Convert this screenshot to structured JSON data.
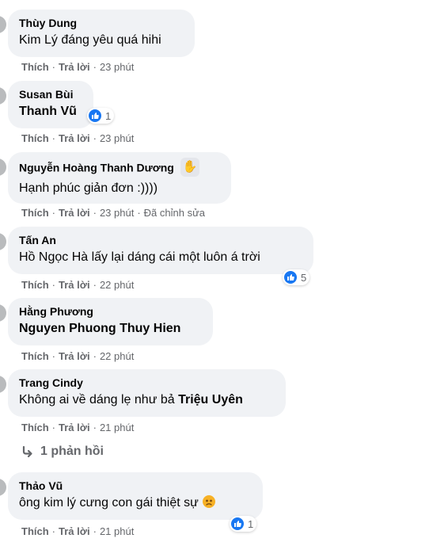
{
  "actions": {
    "like": "Thích",
    "reply": "Trả lời",
    "sep": "·"
  },
  "comments": [
    {
      "author": "Thùy Dung",
      "text": "Kim Lý đáng yêu quá hihi",
      "time": "23 phút"
    },
    {
      "author": "Susan Bùi",
      "text": "Thanh Vũ",
      "time": "23 phút",
      "reactions": "1"
    },
    {
      "author": "Nguyễn Hoàng Thanh Dương",
      "text": "Hạnh phúc giản đơn :))))",
      "time": "23 phút",
      "edited": "Đã chỉnh sửa",
      "badge_icon": "waving-hand-icon"
    },
    {
      "author": "Tấn An",
      "text": "Hồ Ngọc Hà lấy lại dáng cái một luôn á trời",
      "time": "22 phút",
      "reactions": "5"
    },
    {
      "author": "Hằng Phương",
      "text": "Nguyen Phuong Thuy Hien",
      "time": "22 phút"
    },
    {
      "author": "Trang Cindy",
      "text_before": "Không ai về dáng lẹ như bả",
      "mention": "Triệu Uyên",
      "time": "21 phút",
      "replies": "1 phản hồi"
    },
    {
      "author": "Thảo Vũ",
      "text": "ông kim lý cưng con gái thiệt sự",
      "time": "21 phút",
      "reactions": "1",
      "emoji": "sad-face-emoji"
    }
  ],
  "colors": {
    "bubble": "#f0f2f5",
    "meta": "#65676b",
    "like_blue": "#1877f2",
    "text": "#050505"
  }
}
